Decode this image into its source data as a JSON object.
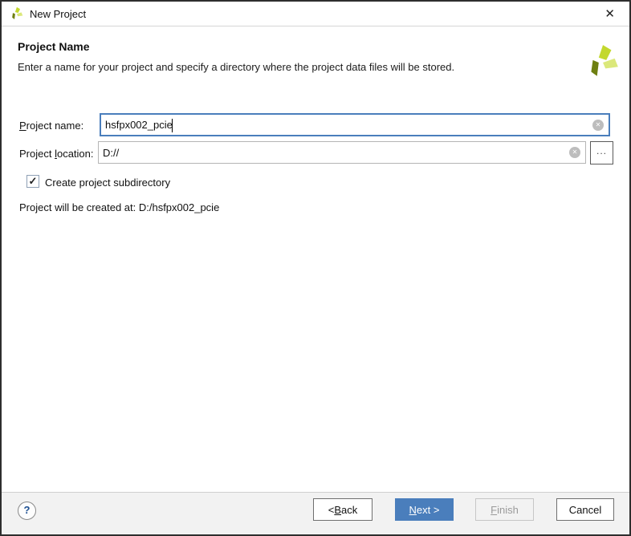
{
  "window": {
    "title": "New Project"
  },
  "icons": {
    "close": "✕",
    "clear": "✕",
    "check": "✓",
    "help": "?",
    "browse": "..."
  },
  "header": {
    "title": "Project Name",
    "description": "Enter a name for your project and specify a directory where the project data files will be stored."
  },
  "form": {
    "project_name": {
      "label": {
        "pre": "",
        "mn": "P",
        "post": "roject name:"
      },
      "value": "hsfpx002_pcie"
    },
    "project_location": {
      "label": {
        "pre": "Project ",
        "mn": "l",
        "post": "ocation:"
      },
      "value": "D://"
    },
    "subdirectory_checkbox": {
      "label": "Create project subdirectory",
      "checked": true
    },
    "created_at_text": "Project will be created at: D:/hsfpx002_pcie"
  },
  "footer": {
    "buttons": {
      "back": {
        "pre": "< ",
        "mn": "B",
        "post": "ack"
      },
      "next": {
        "pre": "",
        "mn": "N",
        "post": "ext >"
      },
      "finish": {
        "pre": "",
        "mn": "F",
        "post": "inish"
      },
      "cancel": {
        "pre": "Cancel",
        "mn": "",
        "post": ""
      }
    }
  },
  "colors": {
    "accent": "#4a7ebc",
    "logo_dark": "#6e7f11",
    "logo_bright": "#c3d82e",
    "logo_light": "#dbe87b"
  }
}
